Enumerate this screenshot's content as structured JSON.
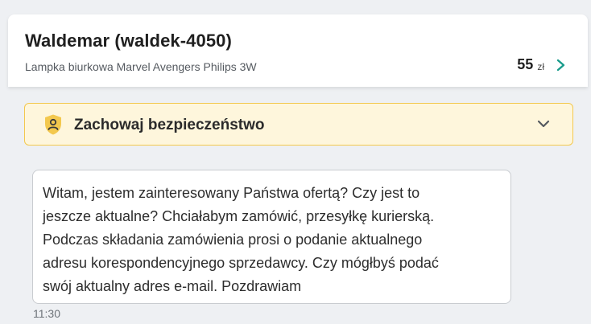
{
  "header": {
    "user_name": "Waldemar (waldek-4050)",
    "product_name": "Lampka biurkowa Marvel Avengers Philips 3W",
    "price_value": "55",
    "price_currency": "zł"
  },
  "safety_banner": {
    "title": "Zachowaj bezpieczeństwo",
    "icon": "shield-user-icon",
    "accent_color": "#f3c84e",
    "background_color": "#fef6dc"
  },
  "message": {
    "text": "Witam, jestem zainteresowany Państwa ofertą? Czy jest to\njeszcze aktualne? Chciałabym zamówić, przesyłkę kurierską.\nPodczas składania zamówienia prosi o podanie aktualnego\nadresu korespondencyjnego sprzedawcy. Czy mógłbyś podać\nswój aktualny adres e-mail. Pozdrawiam",
    "time": "11:30"
  },
  "colors": {
    "accent_teal": "#1a9c8c"
  }
}
